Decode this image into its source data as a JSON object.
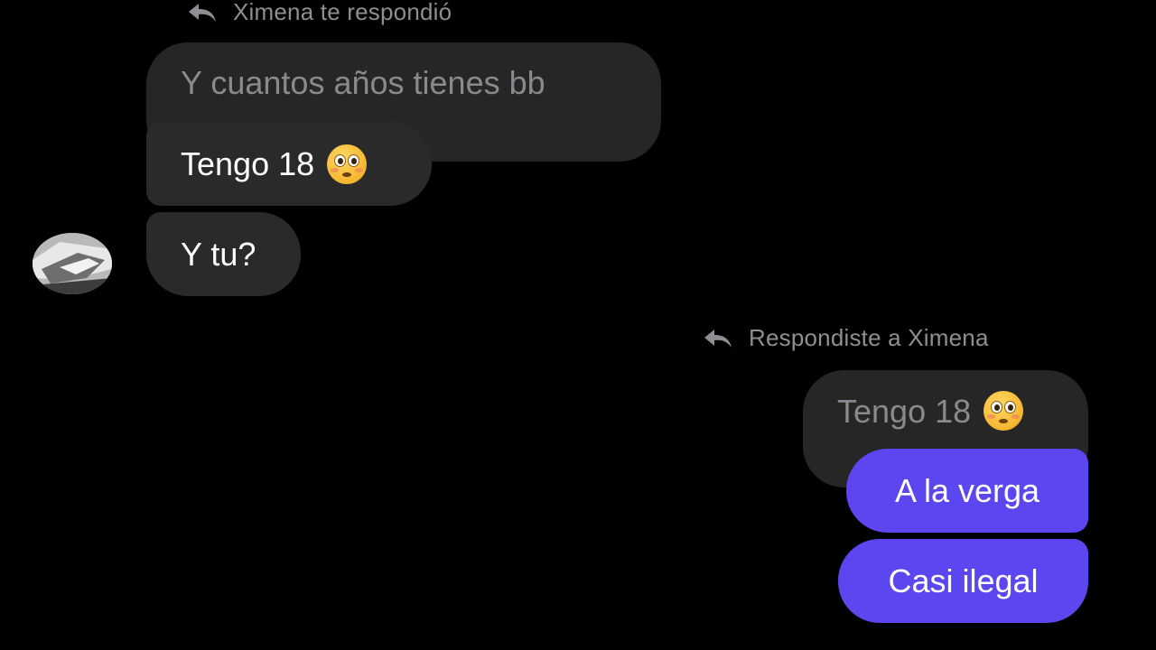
{
  "conversation": {
    "incoming_group": {
      "reply_label": "Ximena te respondió",
      "quoted_text": "Y cuantos años tienes bb",
      "messages": [
        {
          "text": "Tengo 18",
          "emoji": "flushed-face-emoji"
        },
        {
          "text": "Y tu?"
        }
      ]
    },
    "outgoing_group": {
      "reply_label": "Respondiste a Ximena",
      "quoted_text": "Tengo 18",
      "quoted_emoji": "flushed-face-emoji",
      "messages": [
        {
          "text": "A la verga"
        },
        {
          "text": "Casi ilegal"
        }
      ]
    }
  },
  "colors": {
    "background": "#000000",
    "incoming_bubble": "#2a2a2a",
    "quoted_bubble": "#262626",
    "outgoing_bubble": "#5b46f0",
    "label_text": "#8e8e93"
  },
  "icons": {
    "reply": "reply-arrow-icon",
    "avatar": "contact-avatar"
  }
}
